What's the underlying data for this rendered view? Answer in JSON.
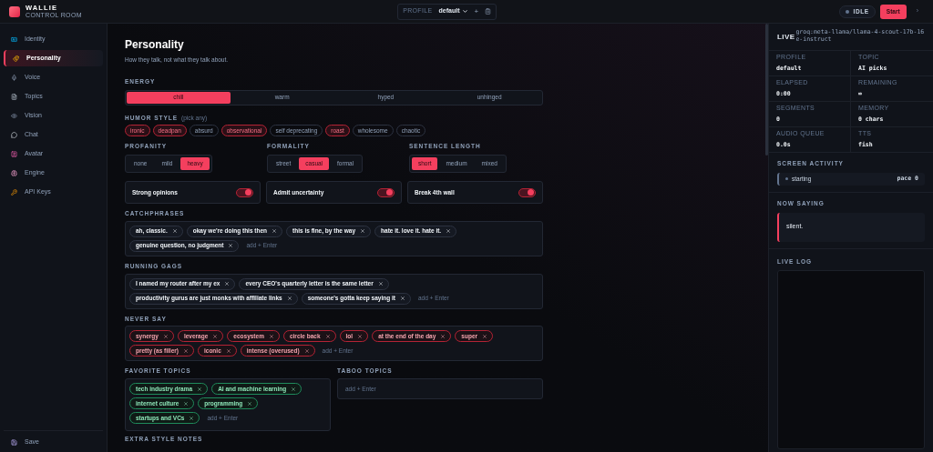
{
  "brand": {
    "name": "WALLIE",
    "subtitle": "CONTROL ROOM"
  },
  "header": {
    "profile_label": "PROFILE",
    "profile_value": "default",
    "add": "+",
    "status": "IDLE",
    "start": "Start",
    "more": "›"
  },
  "sidebar": {
    "items": [
      {
        "label": "Identity",
        "kind": "id",
        "selected": false
      },
      {
        "label": "Personality",
        "kind": "masks",
        "selected": true
      },
      {
        "label": "Voice",
        "kind": "mic",
        "selected": false
      },
      {
        "label": "Topics",
        "kind": "memo",
        "selected": false
      },
      {
        "label": "Vision",
        "kind": "eye",
        "selected": false
      },
      {
        "label": "Chat",
        "kind": "chat",
        "selected": false
      },
      {
        "label": "Avatar",
        "kind": "avatar",
        "selected": false
      },
      {
        "label": "Engine",
        "kind": "brain",
        "selected": false
      },
      {
        "label": "API Keys",
        "kind": "key",
        "selected": false
      }
    ],
    "save": "Save"
  },
  "page": {
    "title": "Personality",
    "subtitle": "How they talk, not what they talk about.",
    "energy": {
      "label": "ENERGY",
      "options": [
        {
          "label": "chill",
          "selected": true
        },
        {
          "label": "warm",
          "selected": false
        },
        {
          "label": "hyped",
          "selected": false
        },
        {
          "label": "unhinged",
          "selected": false
        }
      ]
    },
    "humor": {
      "label": "HUMOR STYLE",
      "hint": "(pick any)",
      "options": [
        {
          "label": "ironic",
          "selected": true
        },
        {
          "label": "deadpan",
          "selected": true
        },
        {
          "label": "absurd",
          "selected": false
        },
        {
          "label": "observational",
          "selected": true
        },
        {
          "label": "self deprecating",
          "selected": false
        },
        {
          "label": "roast",
          "selected": true
        },
        {
          "label": "wholesome",
          "selected": false
        },
        {
          "label": "chaotic",
          "selected": false
        }
      ]
    },
    "segments": [
      {
        "label": "PROFANITY",
        "options": [
          {
            "label": "none",
            "selected": false
          },
          {
            "label": "mild",
            "selected": false
          },
          {
            "label": "heavy",
            "selected": true
          }
        ]
      },
      {
        "label": "FORMALITY",
        "options": [
          {
            "label": "street",
            "selected": false
          },
          {
            "label": "casual",
            "selected": true
          },
          {
            "label": "formal",
            "selected": false
          }
        ]
      },
      {
        "label": "SENTENCE LENGTH",
        "options": [
          {
            "label": "short",
            "selected": true
          },
          {
            "label": "medium",
            "selected": false
          },
          {
            "label": "mixed",
            "selected": false
          }
        ]
      }
    ],
    "toggles": [
      {
        "label": "Strong opinions",
        "on": true
      },
      {
        "label": "Admit uncertainty",
        "on": true
      },
      {
        "label": "Break 4th wall",
        "on": true
      }
    ],
    "tag_sections": [
      {
        "label": "CATCHPHRASES",
        "kind": "neutral",
        "placeholder": "add + Enter",
        "tags": [
          "ah, classic.",
          "okay we're doing this then",
          "this is fine, by the way",
          "hate it. love it. hate it.",
          "genuine question, no judgment"
        ]
      },
      {
        "label": "RUNNING GAGS",
        "kind": "neutral",
        "placeholder": "add + Enter",
        "tags": [
          "I named my router after my ex",
          "every CEO's quarterly letter is the same letter",
          "productivity gurus are just monks with affiliate links",
          "someone's gotta keep saying it"
        ]
      },
      {
        "label": "NEVER SAY",
        "kind": "danger",
        "placeholder": "add + Enter",
        "tags": [
          "synergy",
          "leverage",
          "ecosystem",
          "circle back",
          "lol",
          "at the end of the day",
          "super",
          "pretty (as filler)",
          "iconic",
          "intense (overused)"
        ]
      }
    ],
    "topic_sections": [
      {
        "label": "FAVORITE TOPICS",
        "kind": "positive",
        "placeholder": "add + Enter",
        "tags": [
          "tech industry drama",
          "AI and machine learning",
          "internet culture",
          "programming",
          "startups and VCs"
        ]
      },
      {
        "label": "TABOO TOPICS",
        "placeholder": "add + Enter"
      }
    ],
    "extra_label": "EXTRA STYLE NOTES"
  },
  "live": {
    "title": "LIVE",
    "model": "groq:meta-llama/llama-4-scout-17b-16e-instruct",
    "stats": [
      {
        "label": "PROFILE",
        "value": "default"
      },
      {
        "label": "TOPIC",
        "value": "AI picks"
      },
      {
        "label": "ELAPSED",
        "value": "0:00"
      },
      {
        "label": "REMAINING",
        "value": "∞"
      },
      {
        "label": "SEGMENTS",
        "value": "0"
      },
      {
        "label": "MEMORY",
        "value": "0 chars"
      },
      {
        "label": "AUDIO QUEUE",
        "value": "0.0s"
      },
      {
        "label": "TTS",
        "value": "fish"
      }
    ],
    "screen_activity": {
      "label": "SCREEN ACTIVITY",
      "status": "starting",
      "pace": "pace 0"
    },
    "now_saying": {
      "label": "NOW SAYING",
      "text": "silent."
    },
    "log": {
      "label": "LIVE LOG"
    }
  }
}
